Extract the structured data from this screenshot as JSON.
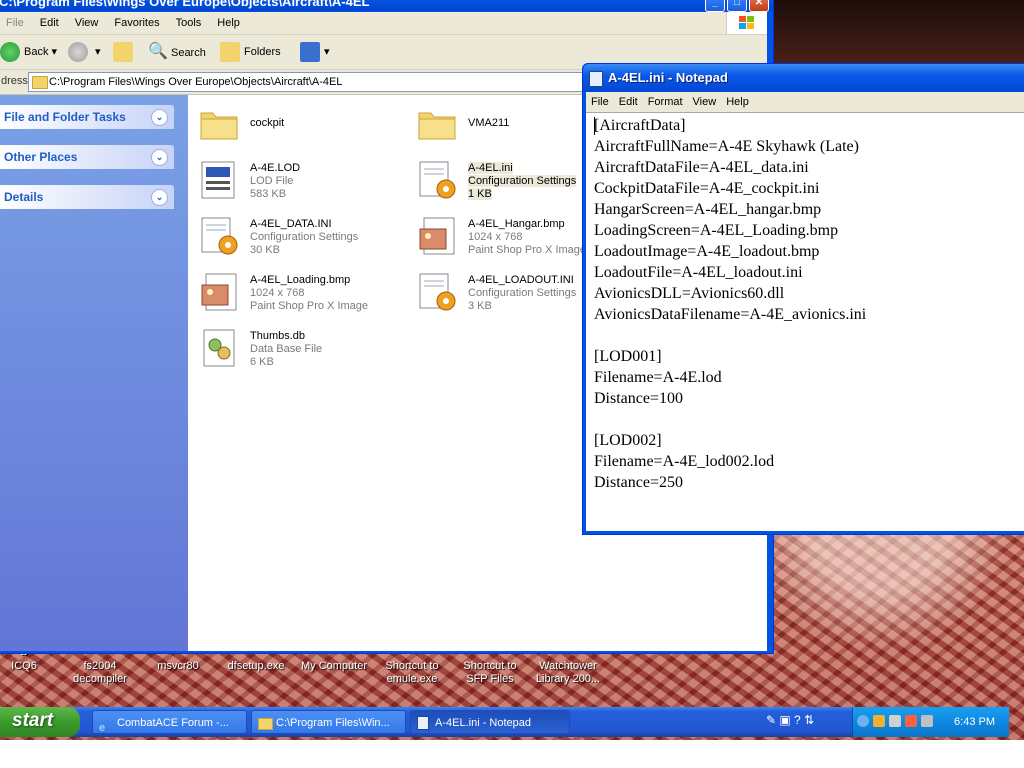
{
  "explorer": {
    "title": "C:\\Program Files\\Wings Over Europe\\Objects\\Aircraft\\A-4EL",
    "menu": [
      "File",
      "Edit",
      "View",
      "Favorites",
      "Tools",
      "Help"
    ],
    "toolbar": {
      "back": "Back",
      "search": "Search",
      "folders": "Folders"
    },
    "address_label": "dress",
    "address": "C:\\Program Files\\Wings Over Europe\\Objects\\Aircraft\\A-4EL",
    "tasks": {
      "file_folder": "File and Folder Tasks",
      "other_places": "Other Places",
      "details": "Details"
    },
    "files": [
      {
        "name": "cockpit",
        "type": "",
        "size": ""
      },
      {
        "name": "VMA211",
        "type": "",
        "size": ""
      },
      {
        "name": "A-4E.LOD",
        "type": "LOD File",
        "size": "583 KB"
      },
      {
        "name": "A-4EL.ini",
        "type": "Configuration Settings",
        "size": "1 KB"
      },
      {
        "name": "A-4EL_DATA.INI",
        "type": "Configuration Settings",
        "size": "30 KB"
      },
      {
        "name": "A-4EL_Hangar.bmp",
        "type": "1024 x 768",
        "size": "Paint Shop Pro X Image"
      },
      {
        "name": "A-4EL_Loading.bmp",
        "type": "1024 x 768",
        "size": "Paint Shop Pro X Image"
      },
      {
        "name": "A-4EL_LOADOUT.INI",
        "type": "Configuration Settings",
        "size": "3 KB"
      },
      {
        "name": "Thumbs.db",
        "type": "Data Base File",
        "size": "6 KB"
      }
    ]
  },
  "notepad": {
    "title": "A-4EL.ini - Notepad",
    "menu": [
      "File",
      "Edit",
      "Format",
      "View",
      "Help"
    ],
    "content": "[AircraftData]\nAircraftFullName=A-4E Skyhawk (Late)\nAircraftDataFile=A-4EL_data.ini\nCockpitDataFile=A-4E_cockpit.ini\nHangarScreen=A-4EL_hangar.bmp\nLoadingScreen=A-4EL_Loading.bmp\nLoadoutImage=A-4E_loadout.bmp\nLoadoutFile=A-4EL_loadout.ini\nAvionicsDLL=Avionics60.dll\nAvionicsDataFilename=A-4E_avionics.ini\n\n[LOD001]\nFilename=A-4E.lod\nDistance=100\n\n[LOD002]\nFilename=A-4E_lod002.lod\nDistance=250"
  },
  "desktop_icons": [
    {
      "label": "ICQ6"
    },
    {
      "label": "fs2004 decompiler"
    },
    {
      "label": "msvcr80"
    },
    {
      "label": "dfsetup.exe"
    },
    {
      "label": "My Computer"
    },
    {
      "label": "Shortcut to emule.exe"
    },
    {
      "label": "Shortcut to SFP Files"
    },
    {
      "label": "Watchtower Library 200..."
    }
  ],
  "taskbar": {
    "start": "start",
    "tasks": [
      {
        "label": "CombatACE Forum -..."
      },
      {
        "label": "C:\\Program Files\\Win..."
      },
      {
        "label": "A-4EL.ini - Notepad"
      }
    ],
    "clock": "6:43 PM"
  },
  "colors": {
    "xp_blue": "#0054e3",
    "start_green": "#3c9a2d",
    "taskpane_blue": "#6375d6"
  }
}
